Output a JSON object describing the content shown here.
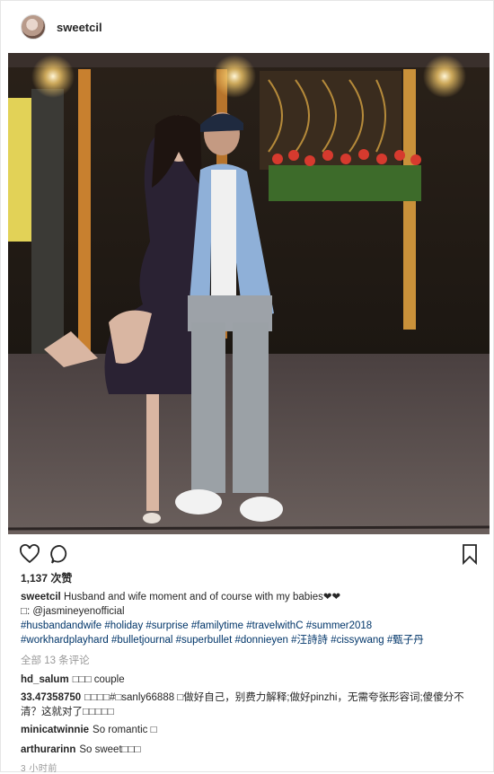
{
  "post": {
    "username": "sweetcil",
    "likes": "1,137 次赞",
    "caption": {
      "username": "sweetcil",
      "text": "Husband and wife moment and of course with my babies❤❤",
      "credit": "□: @jasmineyenofficial",
      "hashtags_line1": "#husbandandwife #holiday #surprise #familytime #travelwithC #summer2018",
      "hashtags_line2": "#workhardplayhard #bulletjournal #superbullet #donnieyen #汪詩詩 #cissywang #甄子丹"
    },
    "view_all_comments": "全部 13 条评论",
    "comments": [
      {
        "user": "hd_salum",
        "text": "□□□ couple"
      },
      {
        "user": "33.47358750",
        "text": "□□□□#□sanly66888 □做好自己，别费力解释;做好pinzhi，无需夸张形容词;傻傻分不清？这就对了□□□□□"
      },
      {
        "user": "minicatwinnie",
        "text": "So romantic □"
      },
      {
        "user": "arthurarinn",
        "text": "So sweet□□□"
      }
    ],
    "timestamp": "3 小时前"
  },
  "icons": {
    "like": "heart-icon",
    "comment": "comment-bubble-icon",
    "save": "bookmark-icon"
  }
}
